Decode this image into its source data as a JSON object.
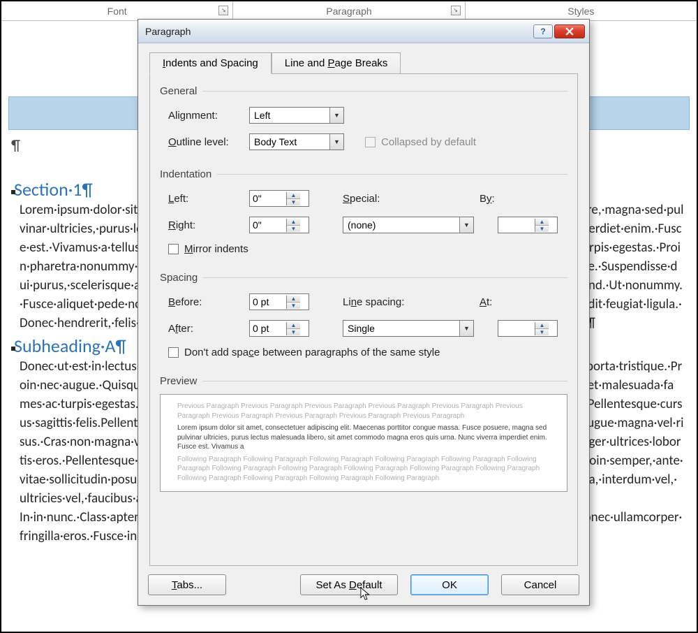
{
  "ribbon": {
    "groups": [
      "Font",
      "Paragraph",
      "Styles"
    ]
  },
  "document": {
    "pilcrow": "¶",
    "heading1": "Section·1¶",
    "para1": "Lorem·ipsum·dolor·sit·amet,·consectetuer·adipiscing·elit.·Maecenas·porttitor·congue·massa.·Fusce·posuere,·magna·sed·pulvinar·ultricies,·purus·lectus·malesuada·libero,·sit·amet·commodo·magna·eros·quis·urna.·Nunc·viverra·imperdiet·enim.·Fusce·est.·Vivamus·a·tellus.·Pellentesque·habitant·morbi·tristique·senectus·et·netus·et·malesuada·fames·ac·turpis·egestas.·Proin·pharetra·nonummy·pede.·Mauris·et·orci.·Aenean·nec·lorem.·In·porttitor.·Donec·laoreet·nonummy·augue.·Suspendisse·dui·purus,·scelerisque·at,·vulputate·vitae,·pretium·mattis,·nunc.·Mauris·eget·neque·at·sem·venenatis·eleifend.·Ut·nonummy.·Fusce·aliquet·pede·non·pede.·Suspendisse·dapibus·lorem·pellentesque·magna.·Integer·nulla.·Donec·blandit·feugiat·ligula.·Donec·hendrerit,·felis·et·imperdiet·euismod,·purus·ipsum·pretium·metus,·in·lacinia·nulla·nisl·eget·sapien.¶",
    "heading2": "Subheading·A¶",
    "para2": "Donec·ut·est·in·lectus·consequat·consequat.·Etiam·eget·dui.·Aliquam·erat·volutpat.·Sed·at·lorem·in·nunc·porta·tristique.·Proin·nec·augue.·Quisque·aliquam·tempor·magna.·Pellentesque·habitant·morbi·tristique·senectus·et·netus·et·malesuada·fames·ac·turpis·egestas.·Nunc·ac·magna.·Maecenas·odio·dolor,·vulputate·vel,·auctor·ac,·accumsan·id,·felis.·Pellentesque·cursus·sagittis·felis.Pellentesque·porttitor,·velit·lacinia·egestas·auctor,·diam·eros·tempus·arcu,·nec·vulputate·augue·magna·vel·risus.·Cras·non·magna·vel·ante·adipiscing·rhoncus.·Vivamus·a·mi.·Morbi·neque.·Aliquam·erat·volutpat.·Integer·ultrices·lobortis·eros.·Pellentesque·habitant·morbi·tristique·senectus·et·netus·et·malesuada·fames·ac·turpis·egestas.·Proin·semper,·ante·vitae·sollicitudin·posuere,·metus·quam·iaculis·nibh,·vitae·scelerisque·nunc·massa·eget·pede.·Sed·velit·urna,·interdum·vel,·ultricies·vel,·faucibus·at,·quam.·Donec·elit·est,·consectetuer·eget,·consequat·quis,·tempus·quis,·wisi.¶",
    "para3": "In·in·nunc.·Class·aptent·taciti·sociosqu·ad·litora·torquent·per·conubia·nostra,·per·inceptos·hymenaeos.·Donec·ullamcorper·fringilla·eros.·Fusce·in·sapien·eu·purus·dapibus·commodo.·Cum·sociis·natoque·"
  },
  "dialog": {
    "title": "Paragraph",
    "tabs": {
      "indents": "Indents and Spacing",
      "breaks": "Line and Page Breaks"
    },
    "general": {
      "title": "General",
      "alignment_label": "Alignment:",
      "alignment_value": "Left",
      "outline_label": "Outline level:",
      "outline_value": "Body Text",
      "collapsed_label": "Collapsed by default"
    },
    "indentation": {
      "title": "Indentation",
      "left_label": "Left:",
      "left_value": "0\"",
      "right_label": "Right:",
      "right_value": "0\"",
      "special_label": "Special:",
      "special_value": "(none)",
      "by_label": "By:",
      "by_value": "",
      "mirror_label": "Mirror indents"
    },
    "spacing": {
      "title": "Spacing",
      "before_label": "Before:",
      "before_value": "0 pt",
      "after_label": "After:",
      "after_value": "0 pt",
      "linesp_label": "Line spacing:",
      "linesp_value": "Single",
      "at_label": "At:",
      "at_value": "",
      "nosame_label": "Don't add space between paragraphs of the same style"
    },
    "preview": {
      "title": "Preview",
      "prev_text": "Previous Paragraph Previous Paragraph Previous Paragraph Previous Paragraph Previous Paragraph Previous Paragraph Previous Paragraph Previous Paragraph Previous Paragraph Previous Paragraph",
      "sample_text": "Lorem ipsum dolor sit amet, consectetuer adipiscing elit. Maecenas porttitor congue massa. Fusce posuere, magna sed pulvinar ultricies, purus lectus malesuada libero, sit amet commodo magna eros quis urna. Nunc viverra imperdiet enim. Fusce est. Vivamus a",
      "follow_text": "Following Paragraph Following Paragraph Following Paragraph Following Paragraph Following Paragraph Following Paragraph Following Paragraph Following Paragraph Following Paragraph Following Paragraph Following Paragraph Following Paragraph Following Paragraph Following Paragraph Following Paragraph"
    },
    "buttons": {
      "tabs": "Tabs...",
      "set_default": "Set As Default",
      "ok": "OK",
      "cancel": "Cancel"
    }
  }
}
